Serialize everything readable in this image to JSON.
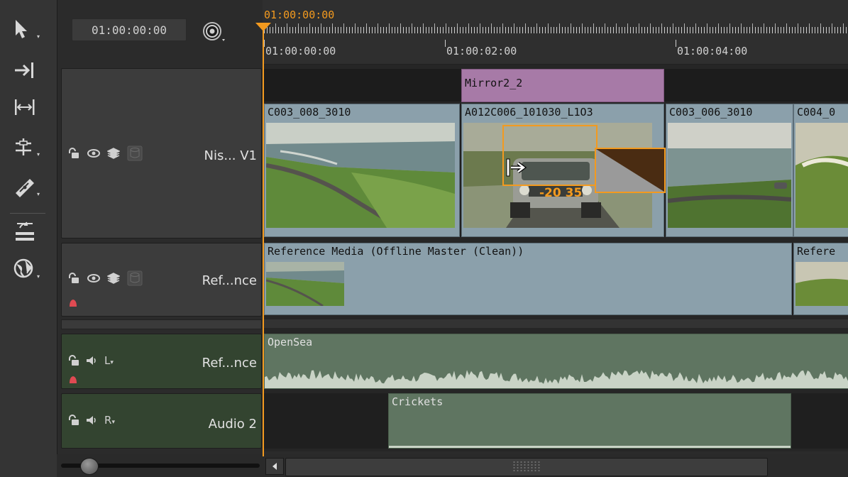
{
  "header": {
    "timecode": "01:00:00:00",
    "playhead_timecode": "01:00:00:00",
    "ruler_labels": [
      "01:00:00:00",
      "01:00:02:00",
      "01:00:04:00"
    ]
  },
  "tracks": {
    "video": [
      {
        "name": "Nis... V1"
      },
      {
        "name": "Ref...nce"
      }
    ],
    "audio": [
      {
        "name": "Ref...nce",
        "channel": "L"
      },
      {
        "name": "Audio 2",
        "channel": "R"
      }
    ]
  },
  "clips": {
    "effect": "Mirror2_2",
    "v1": [
      "C003_008_3010",
      "A012C006_101030_L1O3",
      "C003_006_3010",
      "C004_0"
    ],
    "reference": [
      "Reference Media (Offline Master (Clean))",
      "Refere"
    ],
    "audio1": "OpenSea",
    "audio2": "Crickets"
  },
  "trim_overlay": {
    "offset": "-20",
    "frames": "35"
  },
  "colors": {
    "accent": "#f39a1f",
    "clip": "#8ba0ab",
    "effect": "#a77aa7",
    "audio_clip": "#5f7561",
    "audio_header": "#334430"
  },
  "icons": [
    "arrow-select-icon",
    "slip-icon",
    "ripple-icon",
    "razor-icon",
    "retime-icon",
    "stack-icon",
    "sphere-icon",
    "snap-icon",
    "lock-icon",
    "eye-icon",
    "layers-icon",
    "disk-icon",
    "speaker-icon"
  ]
}
